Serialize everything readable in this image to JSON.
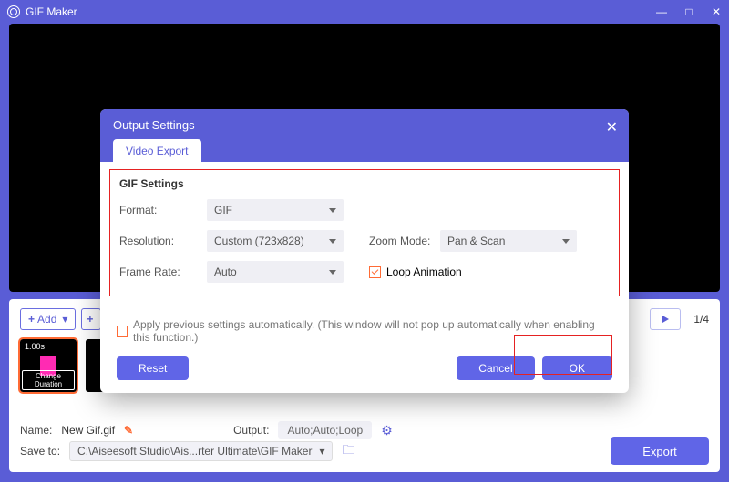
{
  "window": {
    "title": "GIF Maker"
  },
  "lower": {
    "add_label": "Add",
    "counter": "1/4",
    "thumbs": [
      {
        "duration": "1.00s",
        "change": "Change Duration"
      }
    ],
    "name_label": "Name:",
    "name_value": "New Gif.gif",
    "output_label": "Output:",
    "output_value": "Auto;Auto;Loop",
    "save_label": "Save to:",
    "save_path": "C:\\Aiseesoft Studio\\Ais...rter Ultimate\\GIF Maker",
    "export_label": "Export"
  },
  "modal": {
    "title": "Output Settings",
    "tab": "Video Export",
    "section": "GIF Settings",
    "format_label": "Format:",
    "format_value": "GIF",
    "resolution_label": "Resolution:",
    "resolution_value": "Custom (723x828)",
    "zoom_label": "Zoom Mode:",
    "zoom_value": "Pan & Scan",
    "framerate_label": "Frame Rate:",
    "framerate_value": "Auto",
    "loop_label": "Loop Animation",
    "apply_label": "Apply previous settings automatically. (This window will not pop up automatically when enabling this function.)",
    "reset": "Reset",
    "cancel": "Cancel",
    "ok": "OK"
  }
}
